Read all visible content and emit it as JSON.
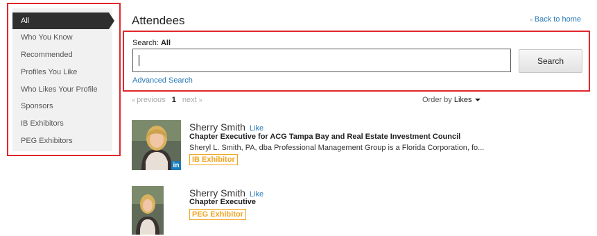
{
  "sidebar": {
    "items": [
      {
        "label": "All",
        "active": true
      },
      {
        "label": "Who You Know"
      },
      {
        "label": "Recommended"
      },
      {
        "label": "Profiles You Like"
      },
      {
        "label": "Who Likes Your Profile"
      },
      {
        "label": "Sponsors"
      },
      {
        "label": "IB Exhibitors"
      },
      {
        "label": "PEG Exhibitors"
      }
    ]
  },
  "header": {
    "title": "Attendees",
    "back_label": "Back to home",
    "back_arrow": "‹‹"
  },
  "search": {
    "label_prefix": "Search:",
    "label_value": "All",
    "input_value": "",
    "button_label": "Search",
    "advanced_label": "Advanced Search"
  },
  "pager": {
    "prev_arrow": "‹‹",
    "prev_label": "previous",
    "current": "1",
    "next_label": "next",
    "next_arrow": "››"
  },
  "order": {
    "prefix": "Order by",
    "value": "Likes"
  },
  "results": [
    {
      "name": "Sherry Smith",
      "like_label": "Like",
      "title": "Chapter Executive for ACG Tampa Bay and Real Estate Investment Council",
      "description": "Sheryl L. Smith, PA, dba Professional Management Group is a Florida Corporation, fo...",
      "badge": "IB Exhibitor",
      "linkedin": "in"
    },
    {
      "name": "Sherry Smith",
      "like_label": "Like",
      "title": "Chapter Executive",
      "badge": "PEG Exhibitor"
    }
  ],
  "colors": {
    "accent_link": "#2a7ab9",
    "highlight_border": "#e0262b",
    "badge": "#f0a520",
    "sidebar_active": "#2f2f2f"
  }
}
